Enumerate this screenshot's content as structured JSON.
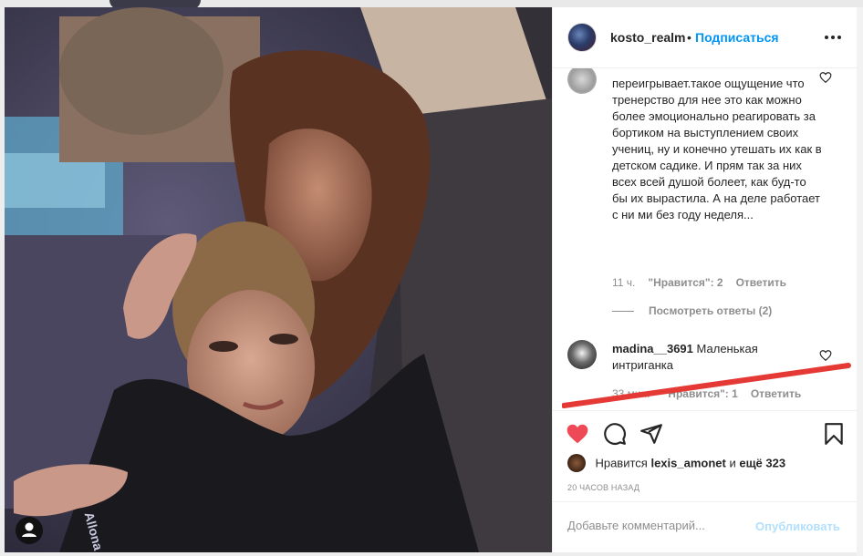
{
  "post": {
    "username": "kosto_realm",
    "separator": "•",
    "follow_label": "Подписаться",
    "more_icon": "more-horizontal-icon"
  },
  "comments": [
    {
      "username_partial": "",
      "text": "переигрывает.такое ощущение что тренерство для нее это как можно более эмоционально реагировать за бортиком на выступлением своих учениц, ну и конечно утешать их как в детском садике. И прям так за них всех всей душой болеет, как буд-то бы их вырастила. А на деле работает с ни ми без году неделя...",
      "time": "11 ч.",
      "likes": "\"Нравится\": 2",
      "reply": "Ответить",
      "view_replies": "Посмотреть ответы (2)"
    },
    {
      "username": "madina__3691",
      "text": "Маленькая интриганка",
      "time": "33 мин.",
      "likes": "\"Нравится\": 1",
      "reply": "Ответить"
    }
  ],
  "actions": {
    "like_icon": "heart-filled-icon",
    "comment_icon": "comment-icon",
    "share_icon": "send-icon",
    "save_icon": "bookmark-icon",
    "like_color": "#ed4956"
  },
  "likes_row": {
    "prefix": "Нравится",
    "user": "lexis_amonet",
    "conj": "и",
    "rest": "ещё 323"
  },
  "timestamp": "20 ЧАСОВ НАЗАД",
  "add_comment": {
    "placeholder": "Добавьте комментарий...",
    "publish_label": "Опубликовать"
  },
  "photo": {
    "jacket_text": "Allona"
  },
  "colors": {
    "link_blue": "#0095f6",
    "publish_disabled": "#b2dffc",
    "annotation_red": "#e53935"
  }
}
